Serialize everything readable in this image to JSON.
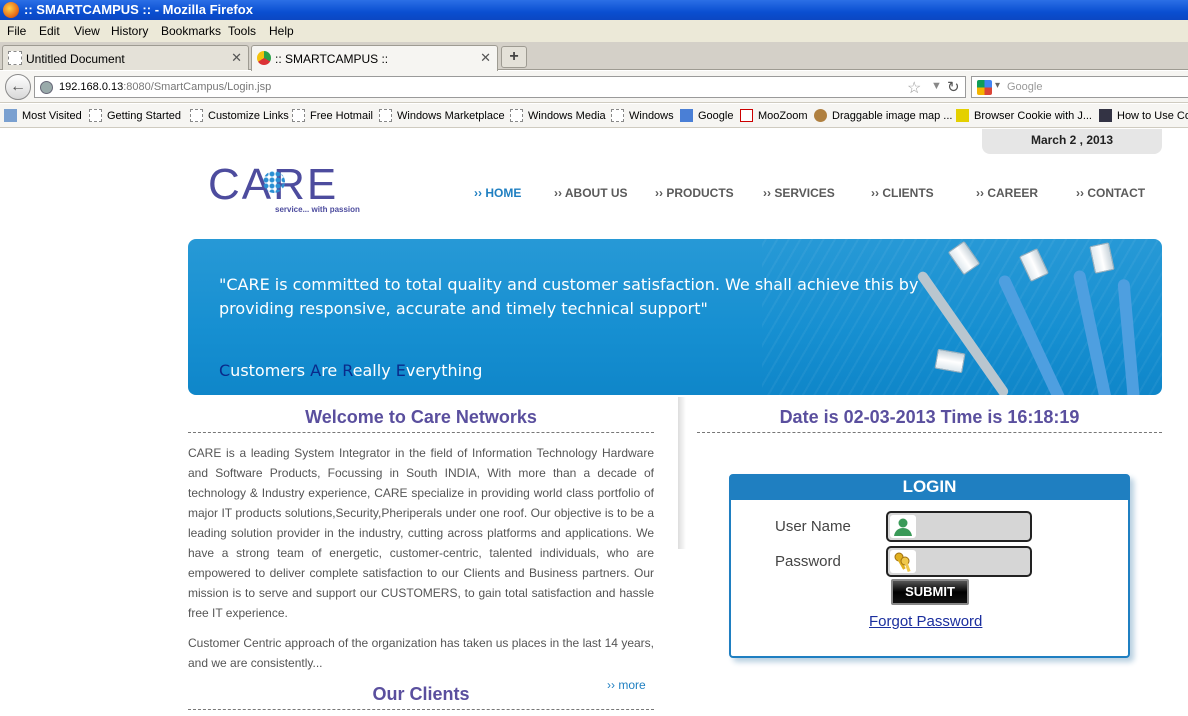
{
  "window": {
    "title": ":: SMARTCAMPUS :: - Mozilla Firefox"
  },
  "menu": [
    "File",
    "Edit",
    "View",
    "History",
    "Bookmarks",
    "Tools",
    "Help"
  ],
  "tabs": [
    {
      "label": "Untitled Document",
      "active": false
    },
    {
      "label": ":: SMARTCAMPUS ::",
      "active": true
    }
  ],
  "address": {
    "host": "192.168.0.13",
    "rest": ":8080/SmartCampus/Login.jsp"
  },
  "search": {
    "placeholder": "Google"
  },
  "bookmarks": [
    "Most Visited",
    "Getting Started",
    "Customize Links",
    "Free Hotmail",
    "Windows Marketplace",
    "Windows Media",
    "Windows",
    "Google",
    "MooZoom",
    "Draggable image map ...",
    "Browser Cookie with J...",
    "How to Use Co"
  ],
  "page": {
    "date_tab": "March 2 , 2013",
    "logo": {
      "word": "CARE",
      "tagline": "service... with passion"
    },
    "nav": [
      "›› HOME",
      "›› ABOUT US",
      "›› PRODUCTS",
      "›› SERVICES",
      "›› CLIENTS",
      "›› CAREER",
      "›› CONTACT"
    ],
    "banner": {
      "quote": "\"CARE is committed to total quality and customer satisfaction. We shall achieve this by providing responsive, accurate and timely technical support\"",
      "motto_words": [
        {
          "cap": "C",
          "rest": "ustomers "
        },
        {
          "cap": "A",
          "rest": "re "
        },
        {
          "cap": "R",
          "rest": "eally "
        },
        {
          "cap": "E",
          "rest": "verything"
        }
      ]
    },
    "welcome_title": "Welcome to Care Networks",
    "about_p1": "CARE is a leading System Integrator in the field of Information Technology Hardware and Software Products, Focussing in South INDIA, With more than a decade of technology & Industry experience, CARE specialize in providing world class portfolio of major IT products solutions,Security,Pheriperals under one roof. Our objective is to be a leading solution provider in the industry, cutting across platforms and applications. We have a strong team of energetic, customer-centric, talented individuals, who are empowered to deliver complete satisfaction to our Clients and Business partners. Our mission is to serve and support our CUSTOMERS, to gain total satisfaction and hassle free IT experience.",
    "about_p2": "Customer Centric approach of the organization has taken us places in the last 14 years, and we are consistently...",
    "more_link": "›› more",
    "clients_title": "Our Clients",
    "datetime": "Date is 02-03-2013 Time is 16:18:19",
    "login": {
      "title": "LOGIN",
      "username_label": "User Name",
      "password_label": "Password",
      "username_value": "",
      "password_value": "",
      "submit_label": "SUBMIT",
      "forgot_label": "Forgot Password"
    }
  }
}
